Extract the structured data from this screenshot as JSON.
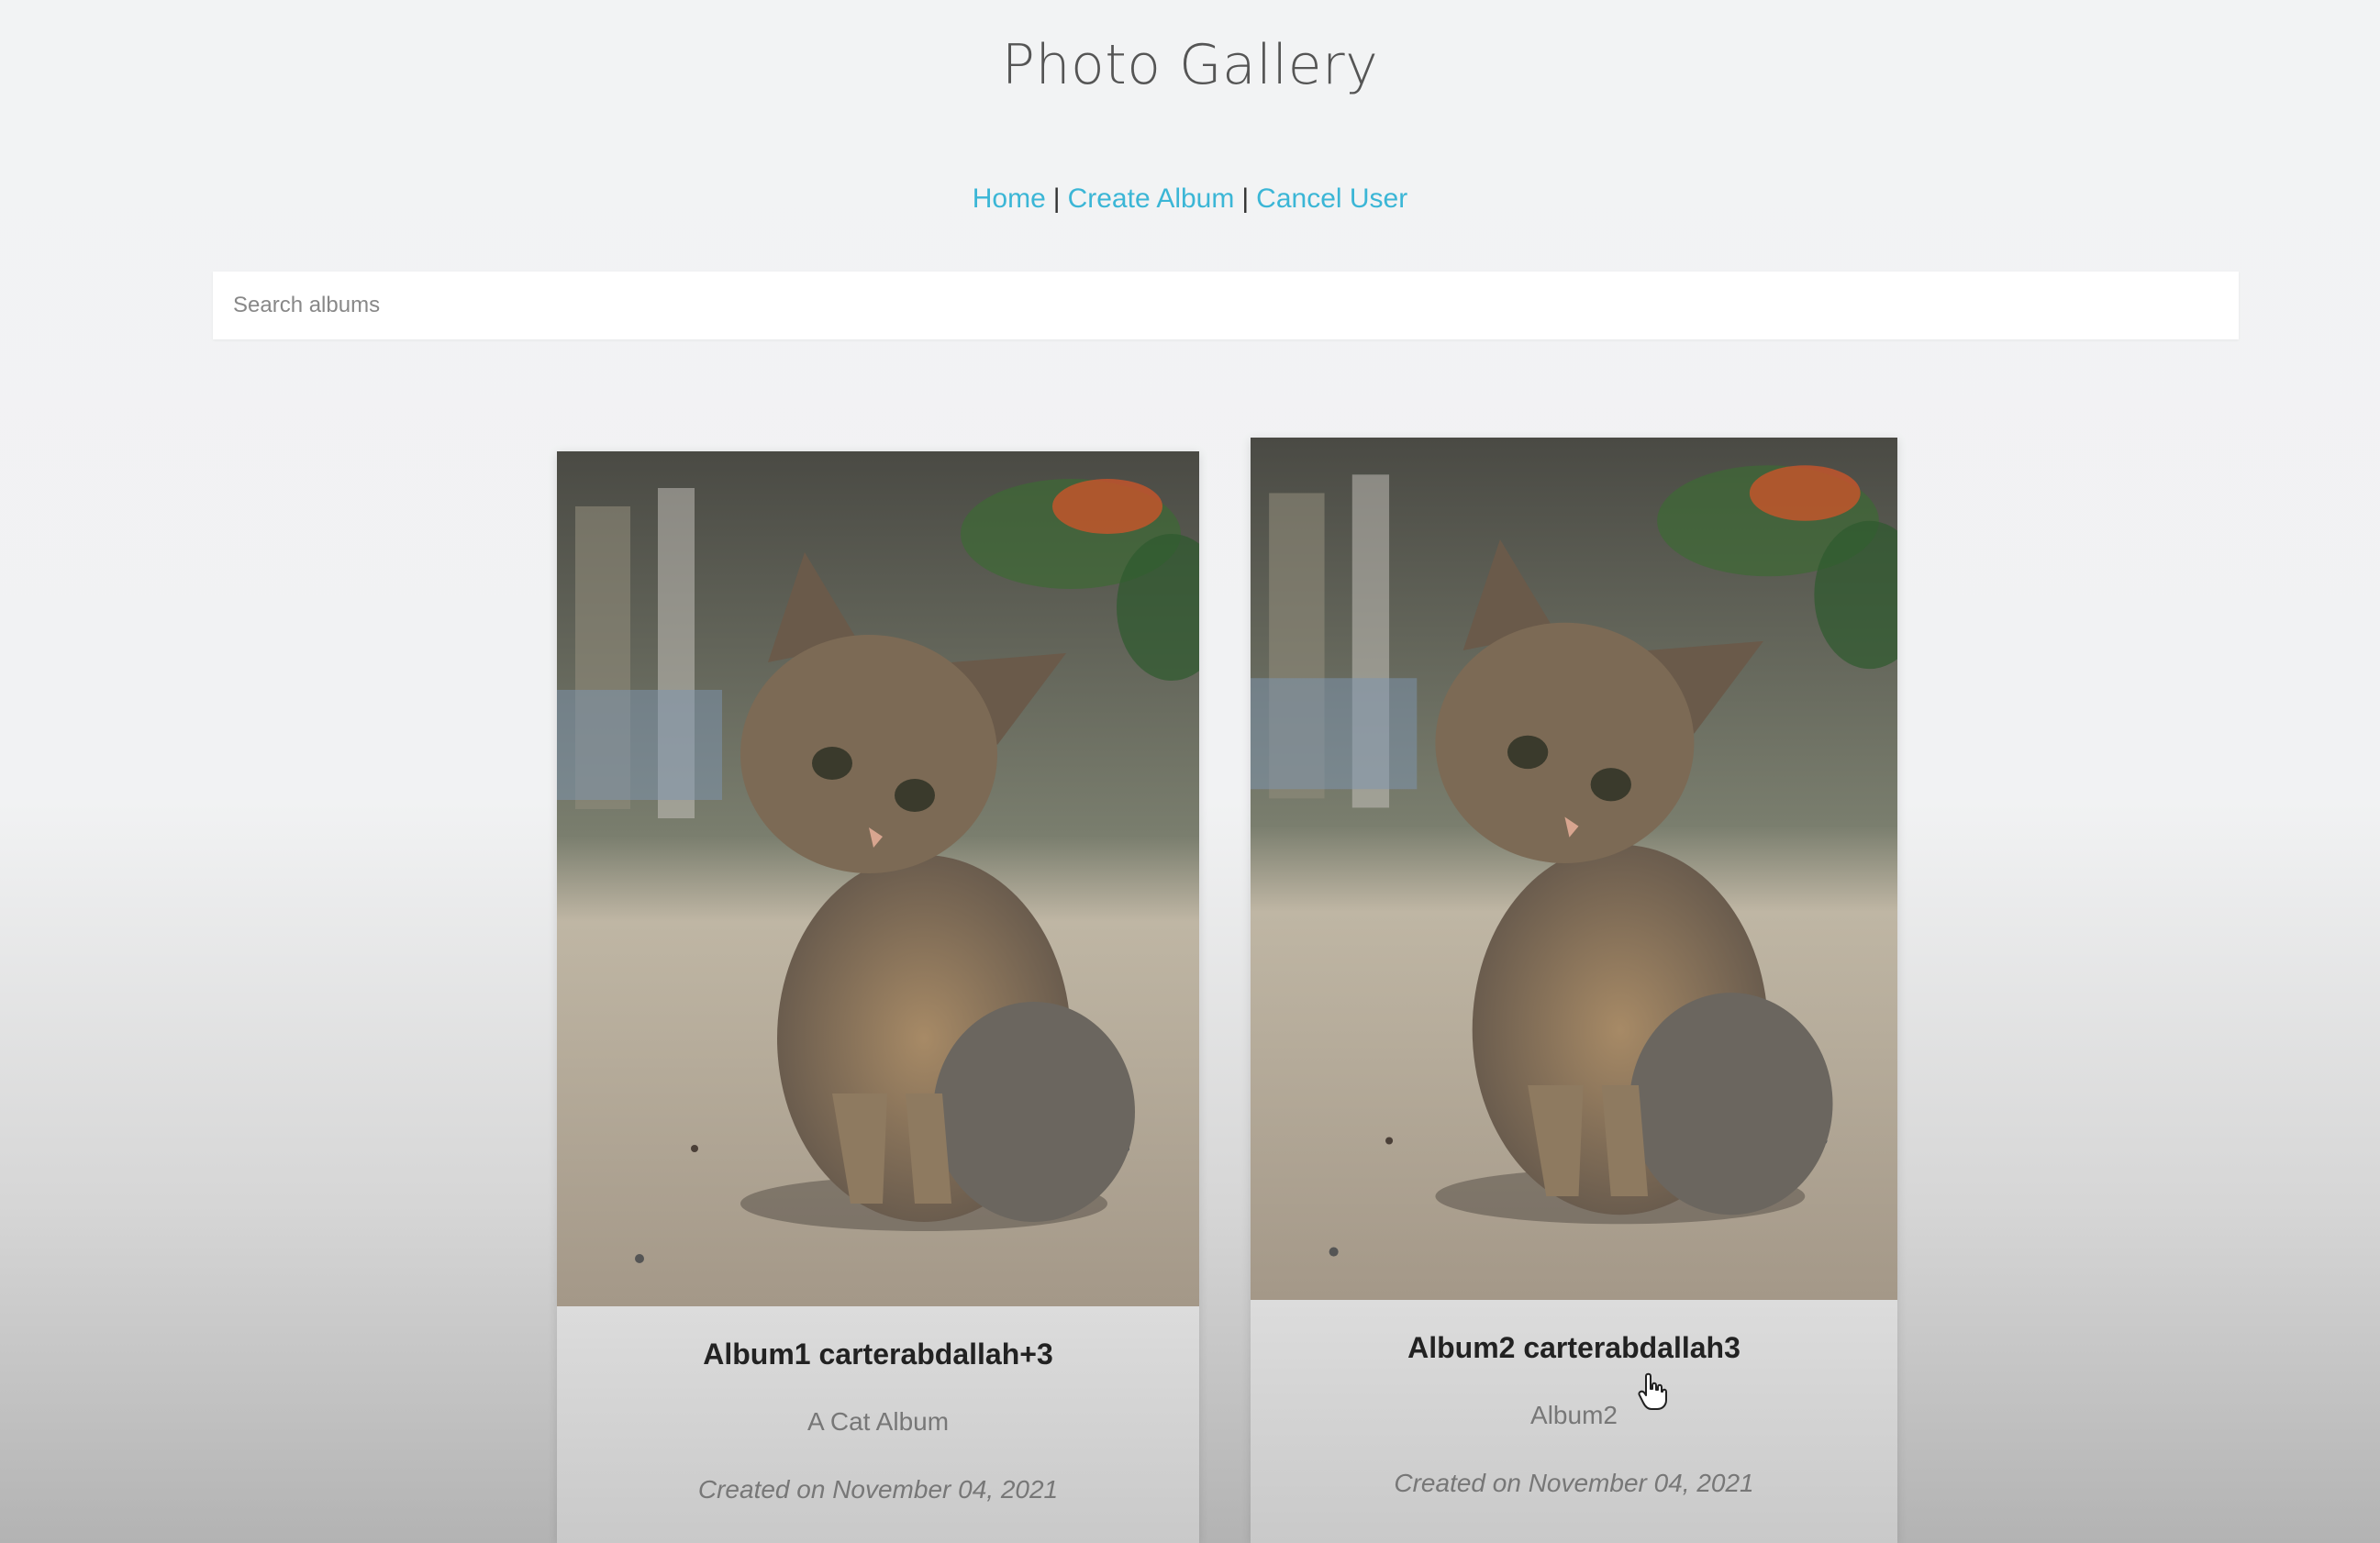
{
  "header": {
    "title": "Photo Gallery"
  },
  "nav": {
    "items": [
      {
        "label": "Home"
      },
      {
        "label": "Create Album"
      },
      {
        "label": "Cancel User"
      }
    ],
    "separator": "|"
  },
  "search": {
    "placeholder": "Search albums",
    "value": ""
  },
  "albums": [
    {
      "title": "Album1 carterabdallah+3",
      "description": "A Cat Album",
      "created": "Created on November 04, 2021",
      "image_icon": "kitten-photo"
    },
    {
      "title": "Album2 carterabdallah3",
      "description": "Album2",
      "created": "Created on November 04, 2021",
      "image_icon": "kitten-photo"
    }
  ],
  "colors": {
    "link": "#3bb6d6",
    "title": "#555555",
    "background": "#f2f3f4"
  },
  "cursor_icon": "hand-pointer-icon"
}
